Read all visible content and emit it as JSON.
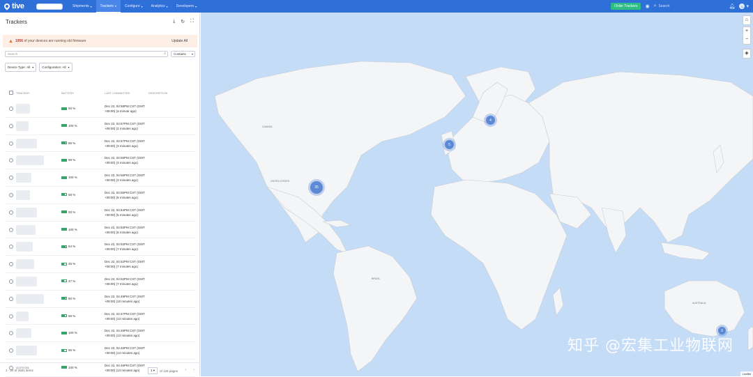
{
  "nav": {
    "logo": "tive",
    "menu": [
      {
        "label": "Shipments",
        "active": false
      },
      {
        "label": "Trackers",
        "active": true
      },
      {
        "label": "Configure",
        "active": false
      },
      {
        "label": "Analytics",
        "active": false
      },
      {
        "label": "Developers",
        "active": false
      }
    ],
    "order_button": "Order Trackers",
    "search_placeholder": "Search",
    "avatar_initial": "U"
  },
  "panel": {
    "title": "Trackers",
    "warning": {
      "count": "1956",
      "text": "of your devices are running old firmware",
      "link": "Update All"
    },
    "search_placeholder": "Search",
    "search_mode": "Contains",
    "filters": [
      {
        "label": "Device Type:",
        "value": "All"
      },
      {
        "label": "Configuration:",
        "value": "All"
      }
    ],
    "columns": [
      "TRACKER",
      "BATTERY",
      "LAST CONNECTED",
      "DESCRIPTION"
    ],
    "rows": [
      {
        "tracker": "",
        "battery": "93 %",
        "battery_level": 0.93,
        "last_connected": "Dec 22, 04:58PM CST (GMT +08:00) (a minute ago)"
      },
      {
        "tracker": "",
        "battery": "100 %",
        "battery_level": 1.0,
        "last_connected": "Dec 22, 04:57PM CST (GMT +08:00) (2 minutes ago)"
      },
      {
        "tracker": "",
        "battery": "85 %",
        "battery_level": 0.85,
        "last_connected": "Dec 22, 04:57PM CST (GMT +08:00) (3 minutes ago)"
      },
      {
        "tracker": "",
        "battery": "99 %",
        "battery_level": 0.99,
        "last_connected": "Dec 22, 04:56PM CST (GMT +08:00) (3 minutes ago)"
      },
      {
        "tracker": "",
        "battery": "100 %",
        "battery_level": 1.0,
        "last_connected": "Dec 22, 04:56PM CST (GMT +08:00) (3 minutes ago)"
      },
      {
        "tracker": "",
        "battery": "68 %",
        "battery_level": 0.68,
        "last_connected": "Dec 22, 04:55PM CST (GMT +08:00) (5 minutes ago)"
      },
      {
        "tracker": "",
        "battery": "93 %",
        "battery_level": 0.93,
        "last_connected": "Dec 22, 04:54PM CST (GMT +08:00) (5 minutes ago)"
      },
      {
        "tracker": "",
        "battery": "100 %",
        "battery_level": 1.0,
        "last_connected": "Dec 22, 04:53PM CST (GMT +08:00) (6 minutes ago)"
      },
      {
        "tracker": "",
        "battery": "84 %",
        "battery_level": 0.84,
        "last_connected": "Dec 22, 04:52PM CST (GMT +08:00) (7 minutes ago)"
      },
      {
        "tracker": "",
        "battery": "45 %",
        "battery_level": 0.45,
        "last_connected": "Dec 22, 04:52PM CST (GMT +08:00) (7 minutes ago)"
      },
      {
        "tracker": "",
        "battery": "47 %",
        "battery_level": 0.47,
        "last_connected": "Dec 22, 04:52PM CST (GMT +08:00) (7 minutes ago)"
      },
      {
        "tracker": "",
        "battery": "80 %",
        "battery_level": 0.8,
        "last_connected": "Dec 22, 04:49PM CST (GMT +08:00) (10 minutes ago)"
      },
      {
        "tracker": "",
        "battery": "66 %",
        "battery_level": 0.66,
        "last_connected": "Dec 22, 04:47PM CST (GMT +08:00) (13 minutes ago)"
      },
      {
        "tracker": "",
        "battery": "100 %",
        "battery_level": 1.0,
        "last_connected": "Dec 22, 04:46PM CST (GMT +08:00) (13 minutes ago)"
      },
      {
        "tracker": "",
        "battery": "56 %",
        "battery_level": 0.56,
        "last_connected": "Dec 22, 04:46PM CST (GMT +08:00) (13 minutes ago)"
      },
      {
        "tracker": "41370 001",
        "battery": "100 %",
        "battery_level": 1.0,
        "last_connected": "Dec 22, 04:46PM CST (GMT +08:00) (13 minutes ago)"
      }
    ],
    "pagination": {
      "count": "1 - 20 of 2501 items",
      "page": "1",
      "of_pages": "of 126 pages"
    }
  },
  "map": {
    "clusters": [
      "4",
      "5",
      "35",
      "3"
    ],
    "labels": [
      "CANADA",
      "UNITED STATES",
      "BRAZIL",
      "AUSTRALIA"
    ],
    "attribution": "Leaflet",
    "watermark": "知乎 @宏集工业物联网"
  }
}
